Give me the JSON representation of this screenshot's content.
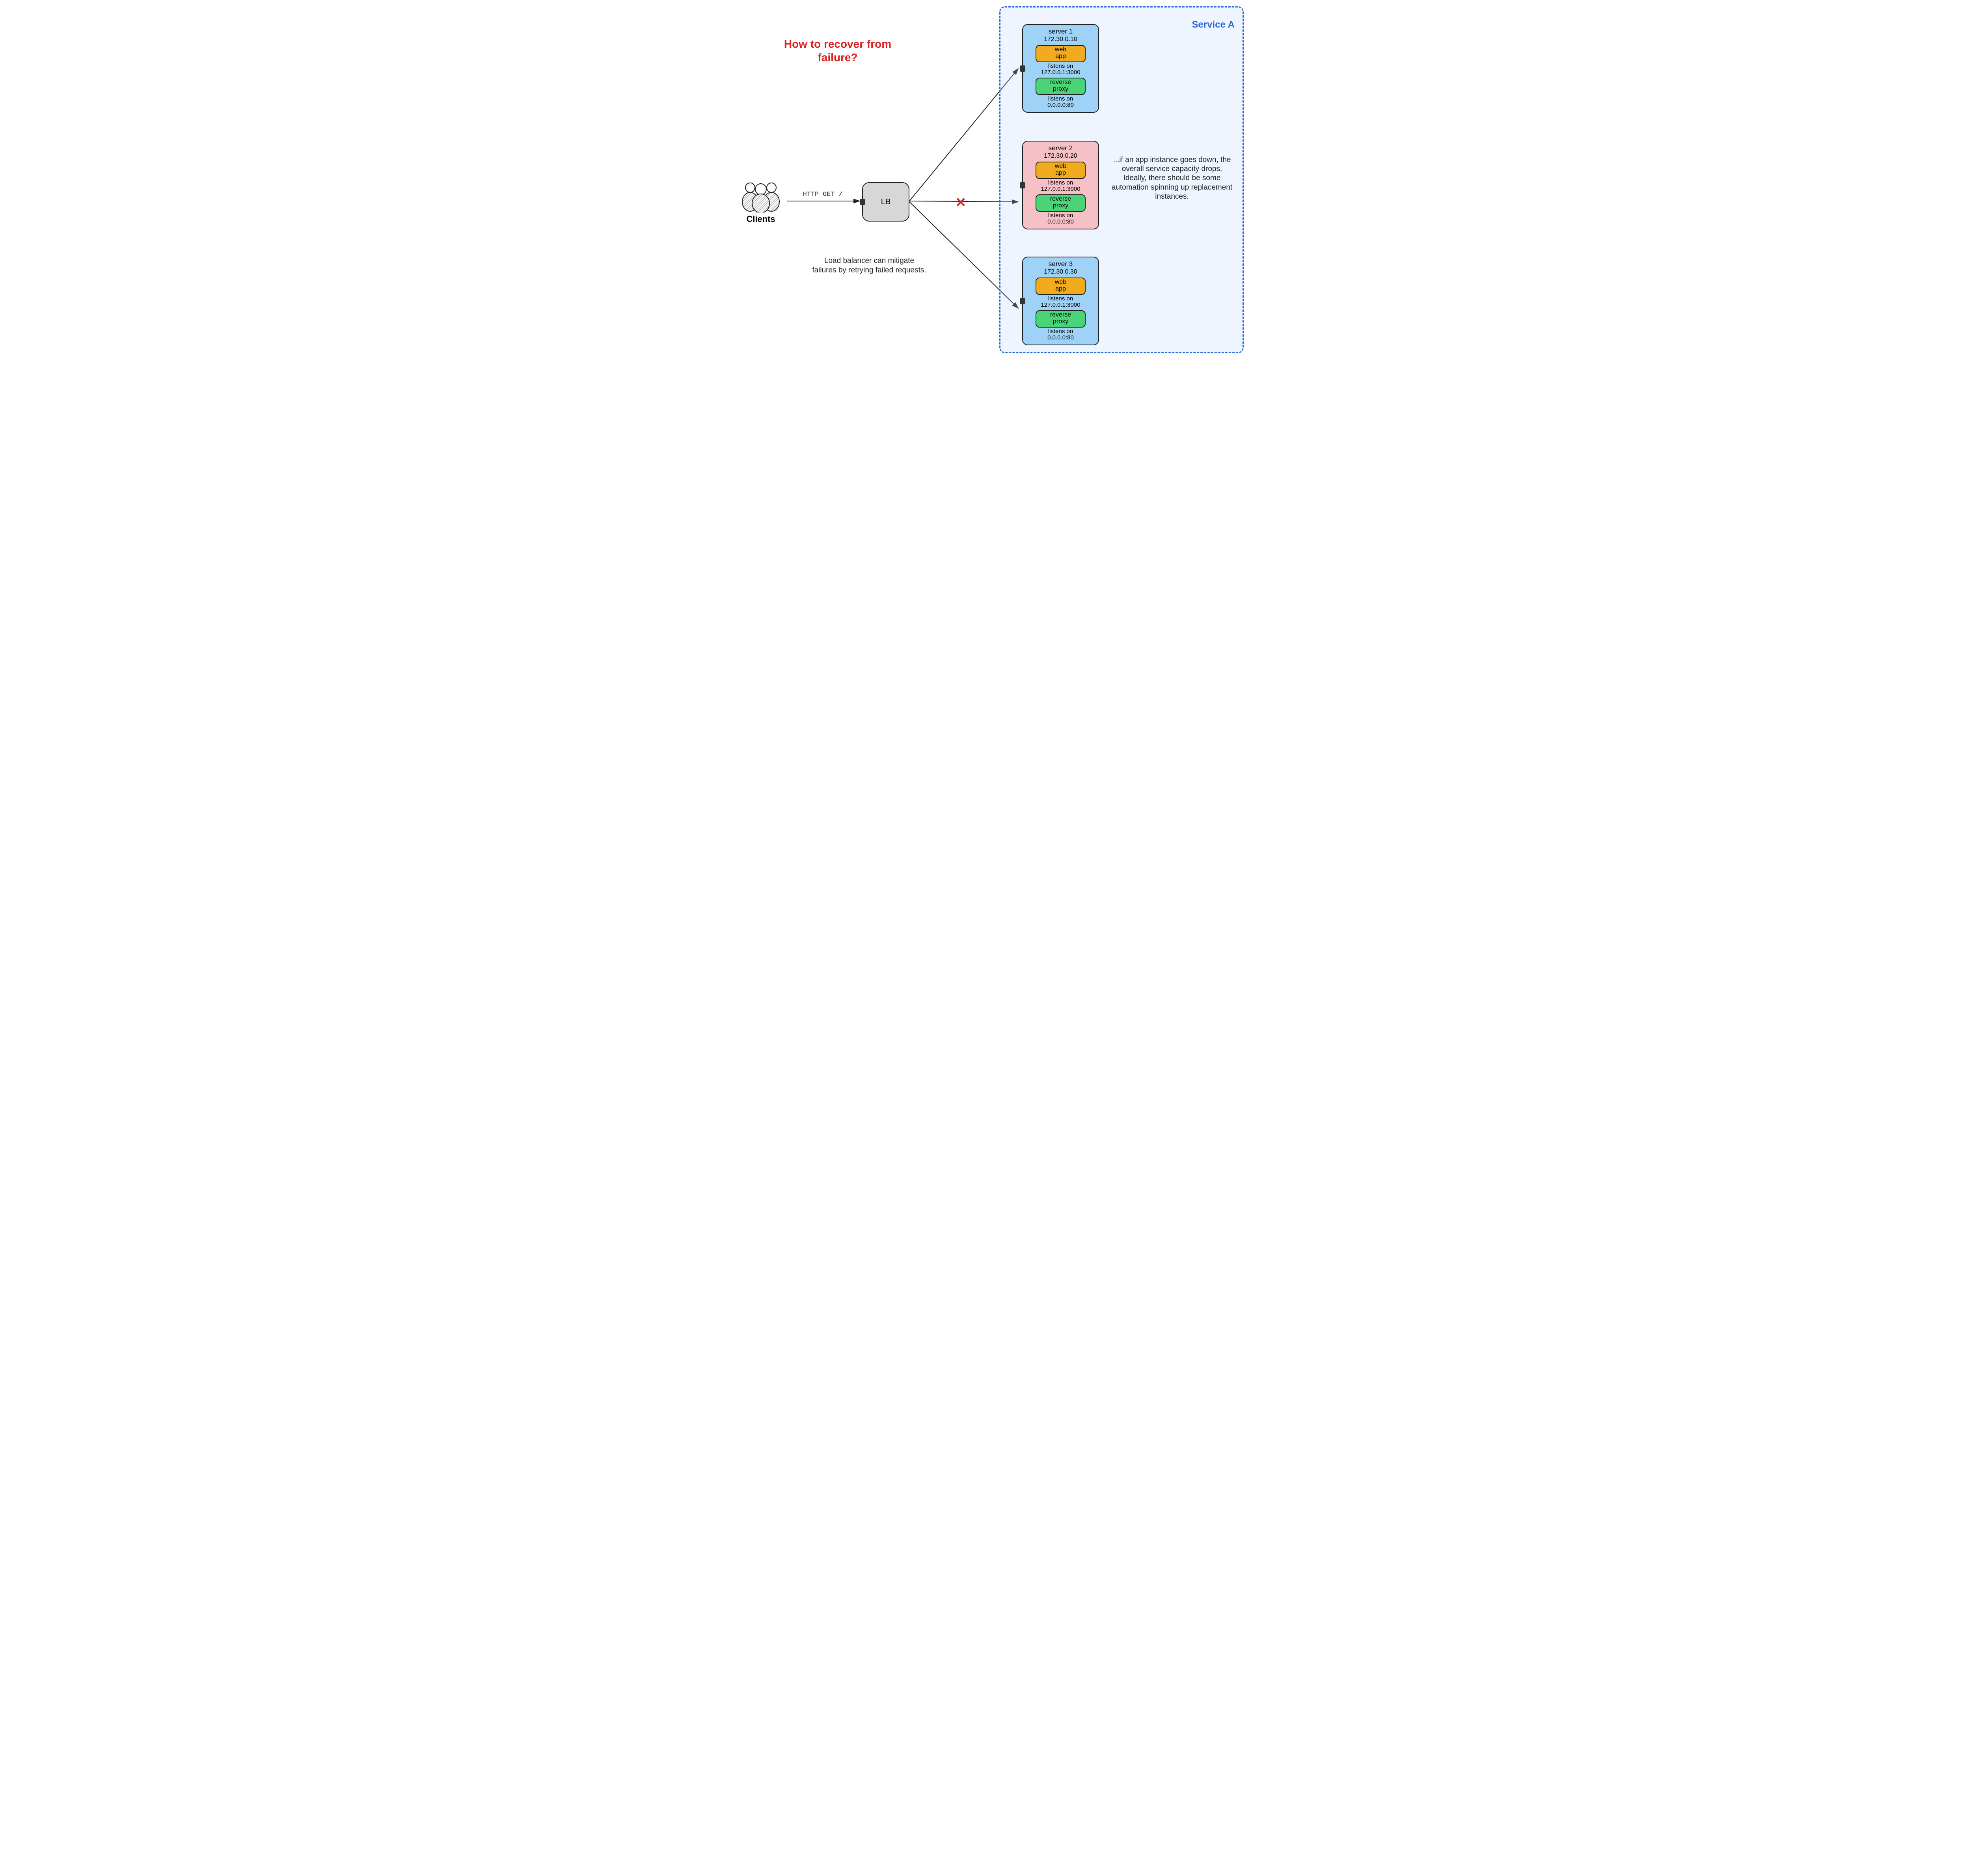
{
  "question": "How to recover from failure?",
  "clients_label": "Clients",
  "http_label": "HTTP GET /",
  "lb_label": "LB",
  "lb_note": "Load balancer can mitigate failures by retrying failed requests.",
  "service_a_label": "Service A",
  "auto_note": "...if an app instance goes down, the overall service capacity drops. Ideally, there should be some automation spinning up replacement instances.",
  "components": {
    "web_line1": "web",
    "web_line2": "app",
    "proxy_line1": "reverse",
    "proxy_line2": "proxy",
    "listens_on": "listens on",
    "web_bind": "127.0.0.1:3000",
    "proxy_bind": "0.0.0.0:80"
  },
  "servers": [
    {
      "name": "server 1",
      "ip": "172.30.0.10",
      "status": "ok"
    },
    {
      "name": "server 2",
      "ip": "172.30.0.20",
      "status": "down"
    },
    {
      "name": "server 3",
      "ip": "172.30.0.30",
      "status": "ok"
    }
  ]
}
